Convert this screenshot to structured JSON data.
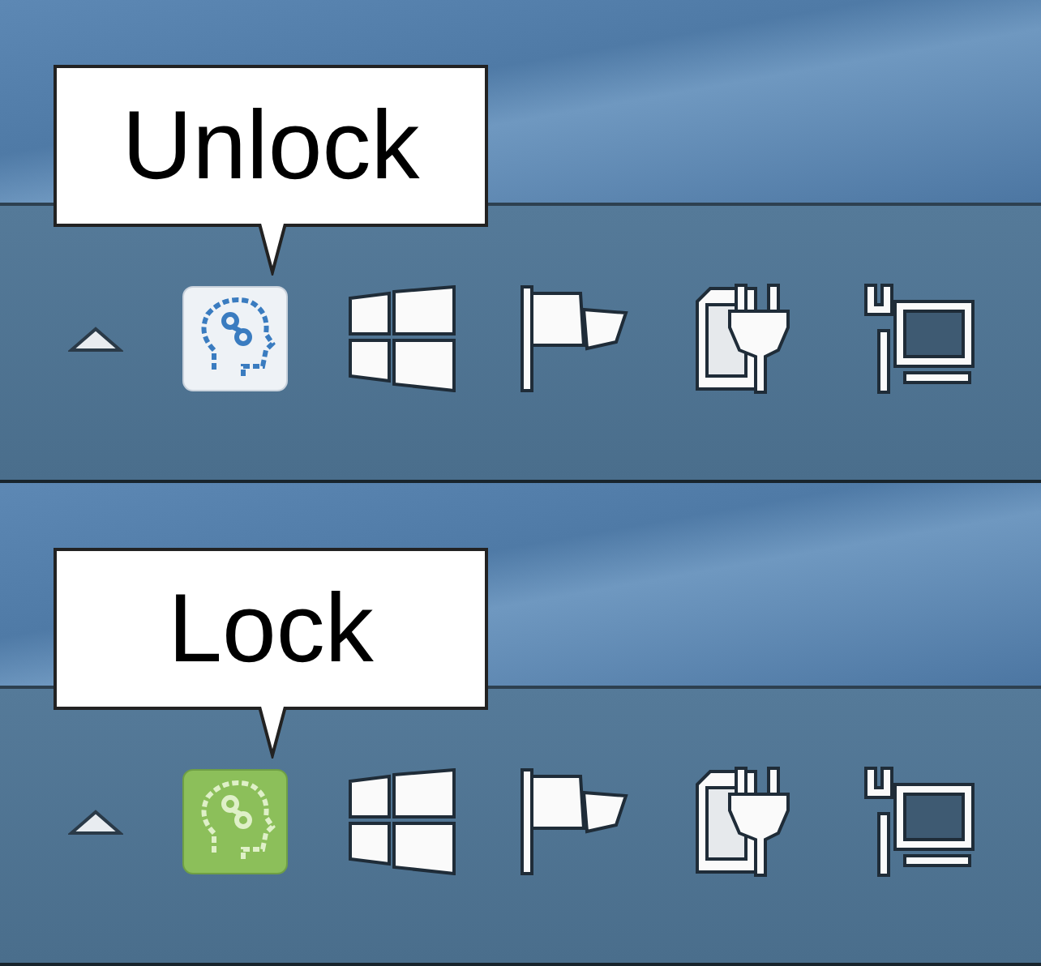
{
  "panels": [
    {
      "tooltip": "Unlock",
      "tray_icon": {
        "on": false
      }
    },
    {
      "tooltip": "Lock",
      "tray_icon": {
        "on": true
      }
    }
  ]
}
